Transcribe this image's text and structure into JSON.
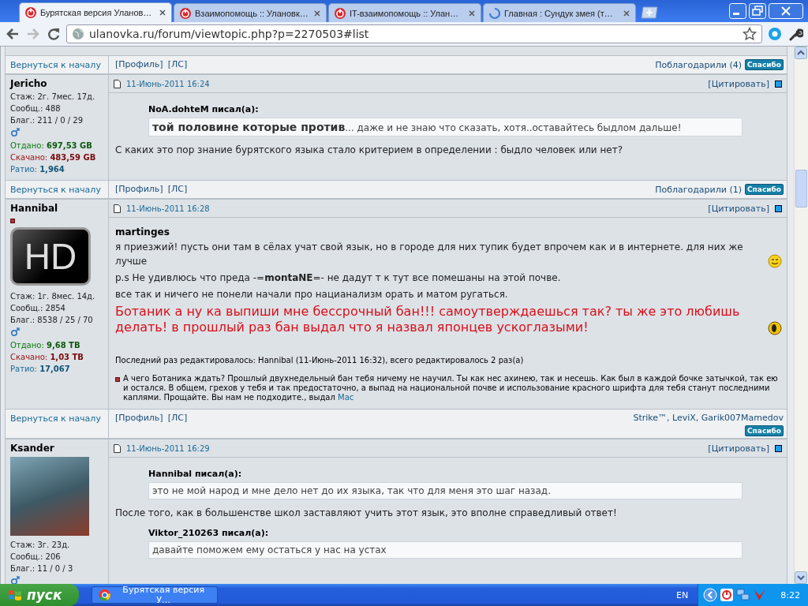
{
  "browser": {
    "tabs": [
      {
        "title": "Бурятская версия Уланов…",
        "selected": true,
        "loading": false
      },
      {
        "title": "Взаимопомощь :: Улановк…",
        "selected": false,
        "loading": false
      },
      {
        "title": "IT-взаимопомощь :: Улан…",
        "selected": false,
        "loading": false
      },
      {
        "title": "Главная : Сундук змея (т…",
        "selected": false,
        "loading": true
      }
    ],
    "url": "ulanovka.ru/forum/viewtopic.php?p=2270503#list"
  },
  "thread": [
    {
      "kind": "footer",
      "back": "Вернуться к началу",
      "profile": "[Профиль]",
      "pm": "[ЛС]",
      "thanks": "Поблагодарили (4)",
      "thanks_button": "Спасибо"
    },
    {
      "kind": "post",
      "author": "Jericho",
      "stats": [
        {
          "kind": "plain",
          "text": "Стаж: 2г. 7мес. 17д."
        },
        {
          "kind": "plain",
          "text": "Сообщ.: 488"
        },
        {
          "kind": "plain",
          "text": "Благ.: 211 / 0 / 29"
        },
        {
          "kind": "male"
        },
        {
          "kind": "up",
          "text": "Отдано: **697,53 GB**"
        },
        {
          "kind": "down",
          "text": "Скачано: **483,59 GB**"
        },
        {
          "kind": "ratio",
          "text": "Ратио: **1,964**"
        }
      ],
      "date": "11-Июнь-2011 16:24",
      "quote_button": "[Цитировать]",
      "body": [
        {
          "kind": "quote",
          "who": "NoA.dohteM писал(а):",
          "text": "**той половине которые против**... даже и не знаю что сказать, хотя..оставайтесь быдлом дальше!"
        },
        {
          "kind": "para",
          "text": "С каких это пор знание бурятского языка стало критерием в определении : быдло человек или нет?"
        }
      ]
    },
    {
      "kind": "footer",
      "back": "Вернуться к началу",
      "profile": "[Профиль]",
      "pm": "[ЛС]",
      "thanks": "Поблагодарили (1)",
      "thanks_button": "Спасибо"
    },
    {
      "kind": "post",
      "author": "Hannibal",
      "rank_mark": true,
      "avatar": {
        "kind": "logo",
        "text": "HD"
      },
      "stats": [
        {
          "kind": "plain",
          "text": "Стаж: 1г. 8мес. 14д."
        },
        {
          "kind": "plain",
          "text": "Сообщ.: 2854"
        },
        {
          "kind": "plain",
          "text": "Благ.: 8538 / 25 / 70"
        },
        {
          "kind": "male"
        },
        {
          "kind": "up",
          "text": "Отдано: **9,68 TB**"
        },
        {
          "kind": "down",
          "text": "Скачано: **1,03 TB**"
        },
        {
          "kind": "ratio",
          "text": "Ратио: **17,067**"
        }
      ],
      "date": "11-Июнь-2011 16:28",
      "quote_button": "[Цитировать]",
      "body": [
        {
          "kind": "name",
          "text": "martinges"
        },
        {
          "kind": "line",
          "text": "я приезжий! пусть они там в сёлах учат свой язык, но в городе для них тупик будет впрочем как и в интернете. для них же лучше",
          "smiley": true
        },
        {
          "kind": "line",
          "text": "p.s Не удивлюсь что преда -=**montaNE**=- не дадут т к тут все помешаны на этой почве."
        },
        {
          "kind": "line",
          "text": "все так и ничего не понели начали про нацианализм орать и матом ругаться."
        },
        {
          "kind": "shout",
          "text": "Ботаник а ну ка выпиши мне бессрочный бан!!! самоутверждаешься так? ты же это любишь делать! в прошлый раз бан выдал что я назвал японцев ускоглазыми!",
          "smiley": true
        },
        {
          "kind": "edit_note",
          "text": "Последний раз редактировалось: Hannibal (11-Июнь-2011 16:32), всего редактировалось 2 раз(а)"
        },
        {
          "kind": "mod_note",
          "text": "А чего Ботаника ждать? Прошлый двухнедельный бан тебя ничему не научил. Ты как нес ахинею, так и несешь. Как был в каждой бочке затычкой, так ею и остался. В общем, грехов у тебя и так предостаточно, а выпад на национальной почве и использование красного шрифта для тебя станут последними каплями. Прощайте. Вы нам не подходите., выдал",
          "link": "Мас"
        }
      ]
    },
    {
      "kind": "footer",
      "back": "Вернуться к началу",
      "profile": "[Профиль]",
      "pm": "[ЛС]",
      "thanks": "Strike™, LeviX, Garik007Mamedov",
      "thanks_button": "Спасибо"
    },
    {
      "kind": "post",
      "author": "Ksander",
      "avatar": {
        "kind": "photo"
      },
      "stats": [
        {
          "kind": "plain",
          "text": "Стаж: 3г. 23д."
        },
        {
          "kind": "plain",
          "text": "Сообщ.: 206"
        },
        {
          "kind": "plain",
          "text": "Благ.: 11 / 0 / 3"
        },
        {
          "kind": "male"
        }
      ],
      "date": "11-Июнь-2011 16:29",
      "quote_button": "[Цитировать]",
      "body": [
        {
          "kind": "quote",
          "who": "Hannibal писал(а):",
          "text": "это не мой народ и мне дело нет до их языка, так что для меня это шаг назад."
        },
        {
          "kind": "para",
          "text": "После того, как в большенстве школ заставляют учить этот язык, это вполне справедливый ответ!"
        },
        {
          "kind": "quote",
          "who": "Viktor_210263 писал(а):",
          "text": "давайте поможем ему остаться у нас на устах"
        }
      ]
    }
  ],
  "taskbar": {
    "start": "пуск",
    "tasks": [
      {
        "title": "Бурятская версия У…",
        "selected": false
      }
    ],
    "language": "EN",
    "clock": "8:22"
  }
}
